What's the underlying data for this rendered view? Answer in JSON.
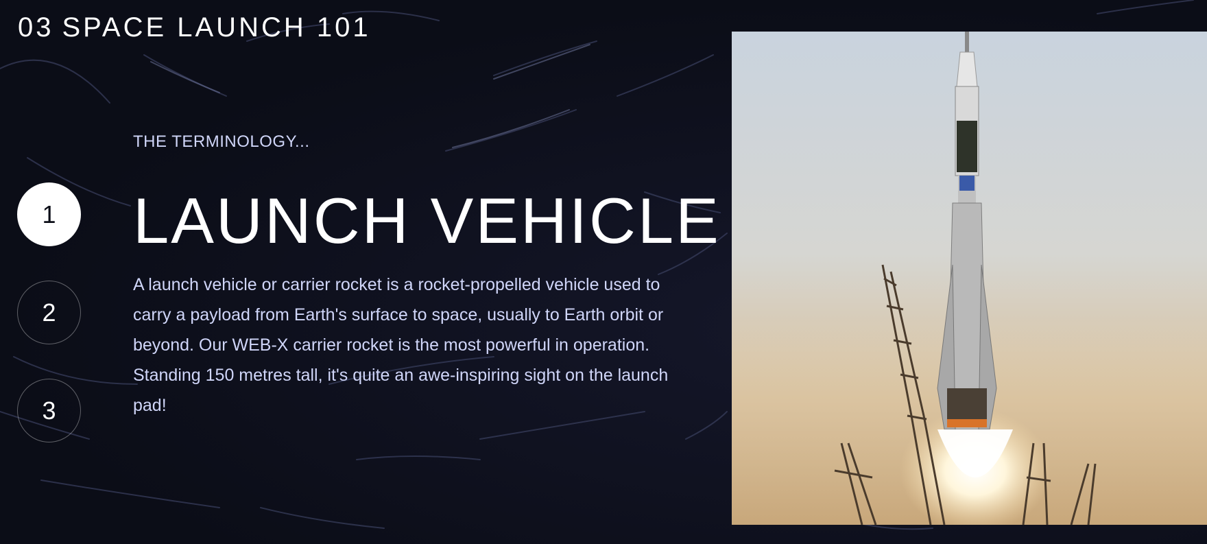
{
  "header": {
    "number": "03",
    "title": "SPACE LAUNCH 101"
  },
  "steps": [
    {
      "label": "1",
      "active": true
    },
    {
      "label": "2",
      "active": false
    },
    {
      "label": "3",
      "active": false
    }
  ],
  "content": {
    "subheading": "THE TERMINOLOGY...",
    "heading": "LAUNCH VEHICLE",
    "description": "A launch vehicle or carrier rocket is a rocket-propelled vehicle used to carry a payload from Earth's surface to space, usually to Earth orbit or beyond. Our WEB-X carrier rocket is the most powerful in operation. Standing 150 metres tall, it's quite an awe-inspiring sight on the launch pad!"
  },
  "image": {
    "subject": "rocket-launch-photo"
  },
  "colors": {
    "background": "#0b0d17",
    "text_secondary": "#d0d6f9",
    "accent": "#ffffff"
  }
}
